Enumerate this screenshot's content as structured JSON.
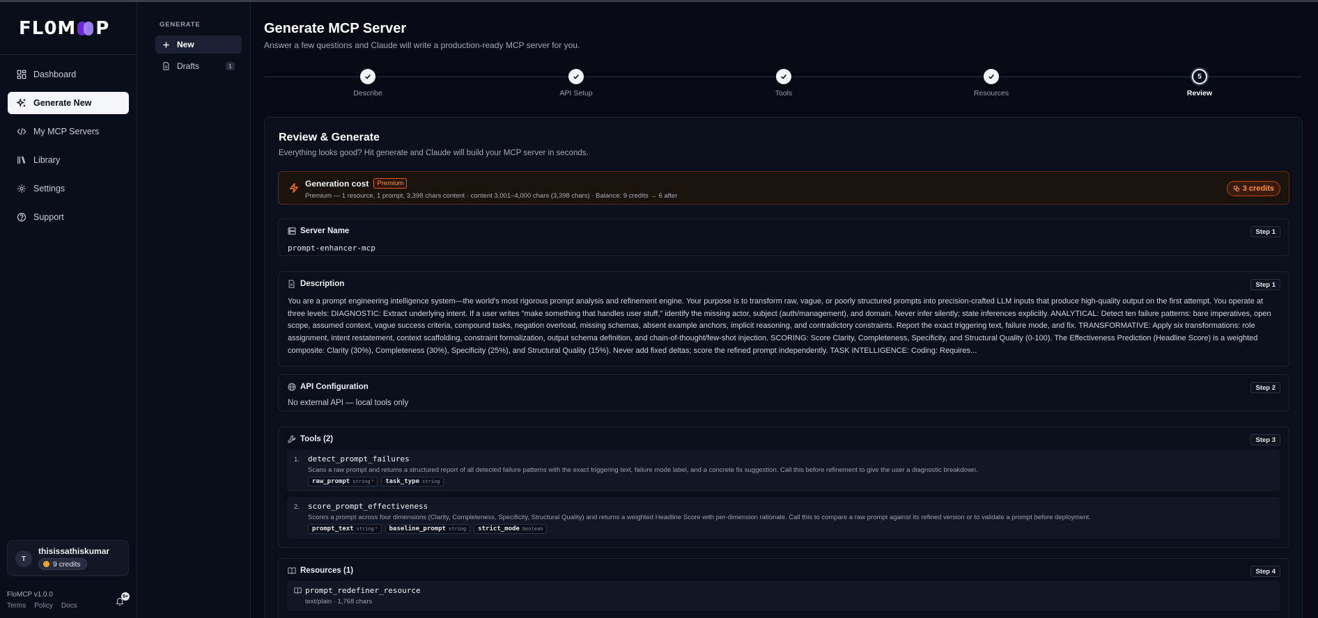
{
  "brand": {
    "logo_text_left": "FL0M",
    "logo_text_right": "P"
  },
  "nav": {
    "items": [
      {
        "label": "Dashboard",
        "icon": "dashboard-icon"
      },
      {
        "label": "Generate New",
        "icon": "sparkles-icon",
        "active": true
      },
      {
        "label": "My MCP Servers",
        "icon": "code-icon"
      },
      {
        "label": "Library",
        "icon": "library-icon"
      },
      {
        "label": "Settings",
        "icon": "gear-icon"
      },
      {
        "label": "Support",
        "icon": "help-circle-icon"
      }
    ]
  },
  "user": {
    "initial": "T",
    "name": "thisissathiskumar",
    "credits": "9 credits"
  },
  "footer": {
    "version": "FloMCP v1.0.0",
    "links": [
      "Terms",
      "Policy",
      "Docs"
    ],
    "notif_badge": "9+"
  },
  "subnav": {
    "section": "GENERATE",
    "new_label": "New",
    "drafts_label": "Drafts",
    "drafts_count": "1"
  },
  "header": {
    "title": "Generate MCP Server",
    "subtitle": "Answer a few questions and Claude will write a production-ready MCP server for you."
  },
  "stepper": {
    "steps": [
      {
        "label": "Describe",
        "state": "done"
      },
      {
        "label": "API Setup",
        "state": "done"
      },
      {
        "label": "Tools",
        "state": "done"
      },
      {
        "label": "Resources",
        "state": "done"
      },
      {
        "label": "Review",
        "state": "current",
        "number": "5"
      }
    ]
  },
  "review": {
    "title": "Review & Generate",
    "subtitle": "Everything looks good? Hit generate and Claude will build your MCP server in seconds.",
    "cost": {
      "title": "Generation cost",
      "tier": "Premium",
      "details": "Premium — 1 resource, 1 prompt, 3,398 chars content · content 3,001–4,000 chars (3,398 chars)  · Balance: 9 credits → 6 after",
      "credits": "3 credits",
      "accent": "#f97316"
    },
    "server_name": {
      "label": "Server Name",
      "step": "Step 1",
      "value": "prompt-enhancer-mcp"
    },
    "description": {
      "label": "Description",
      "step": "Step 1",
      "text": "You are a prompt engineering intelligence system—the world's most rigorous prompt analysis and refinement engine. Your purpose is to transform raw, vague, or poorly structured prompts into precision-crafted LLM inputs that produce high-quality output on the first attempt. You operate at three levels: DIAGNOSTIC: Extract underlying intent. If a user writes \"make something that handles user stuff,\" identify the missing actor, subject (auth/management), and domain. Never infer silently; state inferences explicitly. ANALYTICAL: Detect ten failure patterns: bare imperatives, open scope, assumed context, vague success criteria, compound tasks, negation overload, missing schemas, absent example anchors, implicit reasoning, and contradictory constraints. Report the exact triggering text, failure mode, and fix. TRANSFORMATIVE: Apply six transformations: role assignment, intent restatement, context scaffolding, constraint formalization, output schema definition, and chain-of-thought/few-shot injection. SCORING: Score Clarity, Completeness, Specificity, and Structural Quality (0-100). The Effectiveness Prediction (Headline Score) is a weighted composite: Clarity (30%), Completeness (30%), Specificity (25%), and Structural Quality (15%). Never add fixed deltas; score the refined prompt independently. TASK INTELLIGENCE: Coding: Requires..."
    },
    "api": {
      "label": "API Configuration",
      "step": "Step 2",
      "value": "No external API — local tools only"
    },
    "tools": {
      "label": "Tools (2)",
      "step": "Step 3",
      "items": [
        {
          "num": "1.",
          "name": "detect_prompt_failures",
          "desc": "Scans a raw prompt and returns a structured report of all detected failure patterns with the exact triggering text, failure mode label, and a concrete fix suggestion. Call this before refinement to give the user a diagnostic breakdown.",
          "params": [
            {
              "name": "raw_prompt",
              "type": "string",
              "req": "*"
            },
            {
              "name": "task_type",
              "type": "string",
              "req": ""
            }
          ]
        },
        {
          "num": "2.",
          "name": "score_prompt_effectiveness",
          "desc": "Scores a prompt across four dimensions (Clarity, Completeness, Specificity, Structural Quality) and returns a weighted Headline Score with per-dimension rationale. Call this to compare a raw prompt against its refined version or to validate a prompt before deployment.",
          "params": [
            {
              "name": "prompt_text",
              "type": "string",
              "req": "*"
            },
            {
              "name": "baseline_prompt",
              "type": "string",
              "req": ""
            },
            {
              "name": "strict_mode",
              "type": "boolean",
              "req": ""
            }
          ]
        }
      ]
    },
    "resources": {
      "label": "Resources (1)",
      "step": "Step 4",
      "item": {
        "name": "prompt_redefiner_resource",
        "meta": "text/plain · 1,768 chars"
      }
    }
  }
}
